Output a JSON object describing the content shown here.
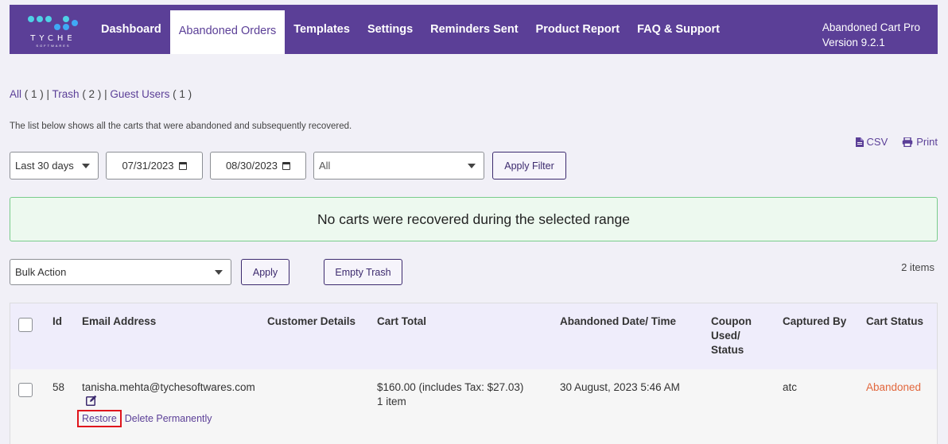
{
  "header": {
    "logo_word": "TYCHE",
    "logo_sub": "SOFTWARES",
    "tabs": [
      {
        "label": "Dashboard"
      },
      {
        "label": "Abandoned Orders"
      },
      {
        "label": "Templates"
      },
      {
        "label": "Settings"
      },
      {
        "label": "Reminders Sent"
      },
      {
        "label": "Product Report"
      },
      {
        "label": "FAQ & Support"
      }
    ],
    "product_name": "Abandoned Cart Pro",
    "version": "Version 9.2.1"
  },
  "subnav": {
    "all_label": "All",
    "all_count": " ( 1 ) | ",
    "trash_label": "Trash",
    "trash_count": " ( 2 ) | ",
    "guest_label": "Guest Users",
    "guest_count": " ( 1 )"
  },
  "description": "The list below shows all the carts that were abandoned and subsequently recovered.",
  "export": {
    "csv_label": "CSV",
    "print_label": "Print"
  },
  "filters": {
    "range_select": "Last 30 days",
    "start_date": "07/31/2023",
    "end_date": "08/30/2023",
    "type_select": "All",
    "apply_filter_label": "Apply Filter"
  },
  "notice": "No carts were recovered during the selected range",
  "bulk": {
    "action_select": "Bulk Action",
    "apply_label": "Apply",
    "empty_trash_label": "Empty Trash",
    "items_count": "2 items"
  },
  "table": {
    "headers": {
      "id": "Id",
      "email": "Email Address",
      "customer": "Customer Details",
      "total": "Cart Total",
      "date": "Abandoned Date/ Time",
      "coupon_1": "Coupon",
      "coupon_2": "Used/",
      "coupon_3": "Status",
      "captured": "Captured By",
      "status": "Cart Status"
    },
    "rows": [
      {
        "id": "58",
        "email": "tanisha.mehta@tychesoftwares.com",
        "total": "$160.00 (includes Tax: $27.03)",
        "items": "1 item",
        "date": "30 August, 2023 5:46 AM",
        "captured": "atc",
        "status": "Abandoned",
        "restore_label": "Restore",
        "delete_label": "Delete Permanently"
      }
    ]
  },
  "colors": {
    "brand": "#5b3f97",
    "abandoned": "#e2673d",
    "notice_bg": "#edf9ef",
    "highlight": "#e0151c"
  }
}
